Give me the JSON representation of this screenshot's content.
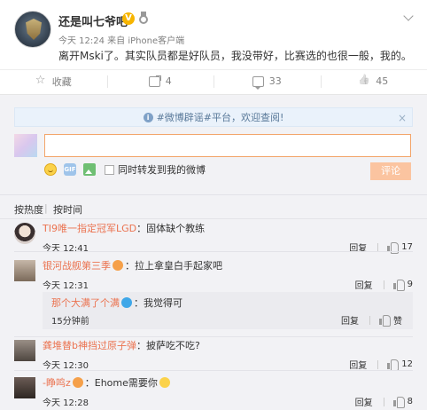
{
  "post": {
    "username": "还是叫七爷吧",
    "meta": "今天 12:24 来自 iPhone客户端",
    "text": "离开Mski了。其实队员都是好队员，我没带好，比赛选的也很一般，我的。",
    "vbadge": "V"
  },
  "actions": {
    "favorite": "收藏",
    "repost": "4",
    "comment": "33",
    "like": "45"
  },
  "notice": {
    "text": "#微博辟谣#平台，欢迎查阅!",
    "info_glyph": "i",
    "close_glyph": "×"
  },
  "composer": {
    "also_repost": "同时转发到我的微博",
    "submit": "评论",
    "gif_label": "GIF"
  },
  "sort": {
    "hot": "按热度",
    "separator": "|",
    "time": "按时间"
  },
  "comments": [
    {
      "user": "TI9唯一指定冠军LGD",
      "sep": "：",
      "text": "固体缺个教练",
      "time": "今天 12:41",
      "reply": "回复",
      "likes": "17"
    },
    {
      "user": "银河战舰第三季",
      "sep": "：",
      "text": "拉上拿皇白手起家吧",
      "time": "今天 12:31",
      "reply": "回复",
      "likes": "9"
    },
    {
      "user": "那个大满了个满",
      "sep": "：",
      "text": "我觉得可",
      "time": "15分钟前",
      "reply": "回复",
      "likes": "赞"
    },
    {
      "user": "龚堆替b神挡过原子弹",
      "sep": "：",
      "text": "披萨吃不吃?",
      "time": "今天 12:30",
      "reply": "回复",
      "likes": "12"
    },
    {
      "user": "-睁鸣z",
      "sep": "：",
      "text": "Ehome需要你",
      "time": "今天 12:28",
      "reply": "回复",
      "likes": "8"
    }
  ],
  "colors": {
    "username_link": "#eb7350",
    "submit_disabled": "#fbc4a0",
    "input_focus_border": "#f3a56a",
    "comments_bg": "#f2f2f5"
  }
}
